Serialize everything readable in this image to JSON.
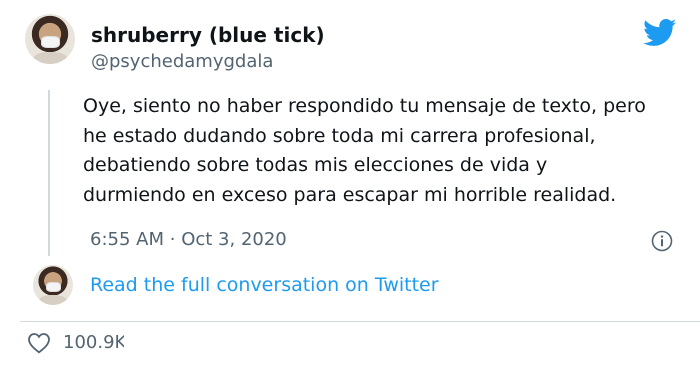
{
  "author": {
    "display_name": "shruberry (blue tick)",
    "handle": "@psychedamygdala"
  },
  "tweet": {
    "lines": [
      "Oye, siento no haber respondido tu mensaje de texto, pero",
      "he estado dudando sobre toda mi carrera profesional,",
      "debatiendo sobre todas mis elecciones de vida y",
      "durmiendo en exceso para escapar mi horrible realidad."
    ],
    "time": "6:55 AM",
    "separator": "·",
    "date": "Oct 3, 2020"
  },
  "actions": {
    "read_conversation": "Read the full conversation on Twitter",
    "likes": "100.9K"
  },
  "icons": {
    "brand": "twitter-bird-icon",
    "info": "info-icon",
    "like": "heart-icon"
  },
  "colors": {
    "brand": "#1d9bf0",
    "text": "#0f1419",
    "muted": "#536471",
    "divider": "#cfd9de"
  }
}
